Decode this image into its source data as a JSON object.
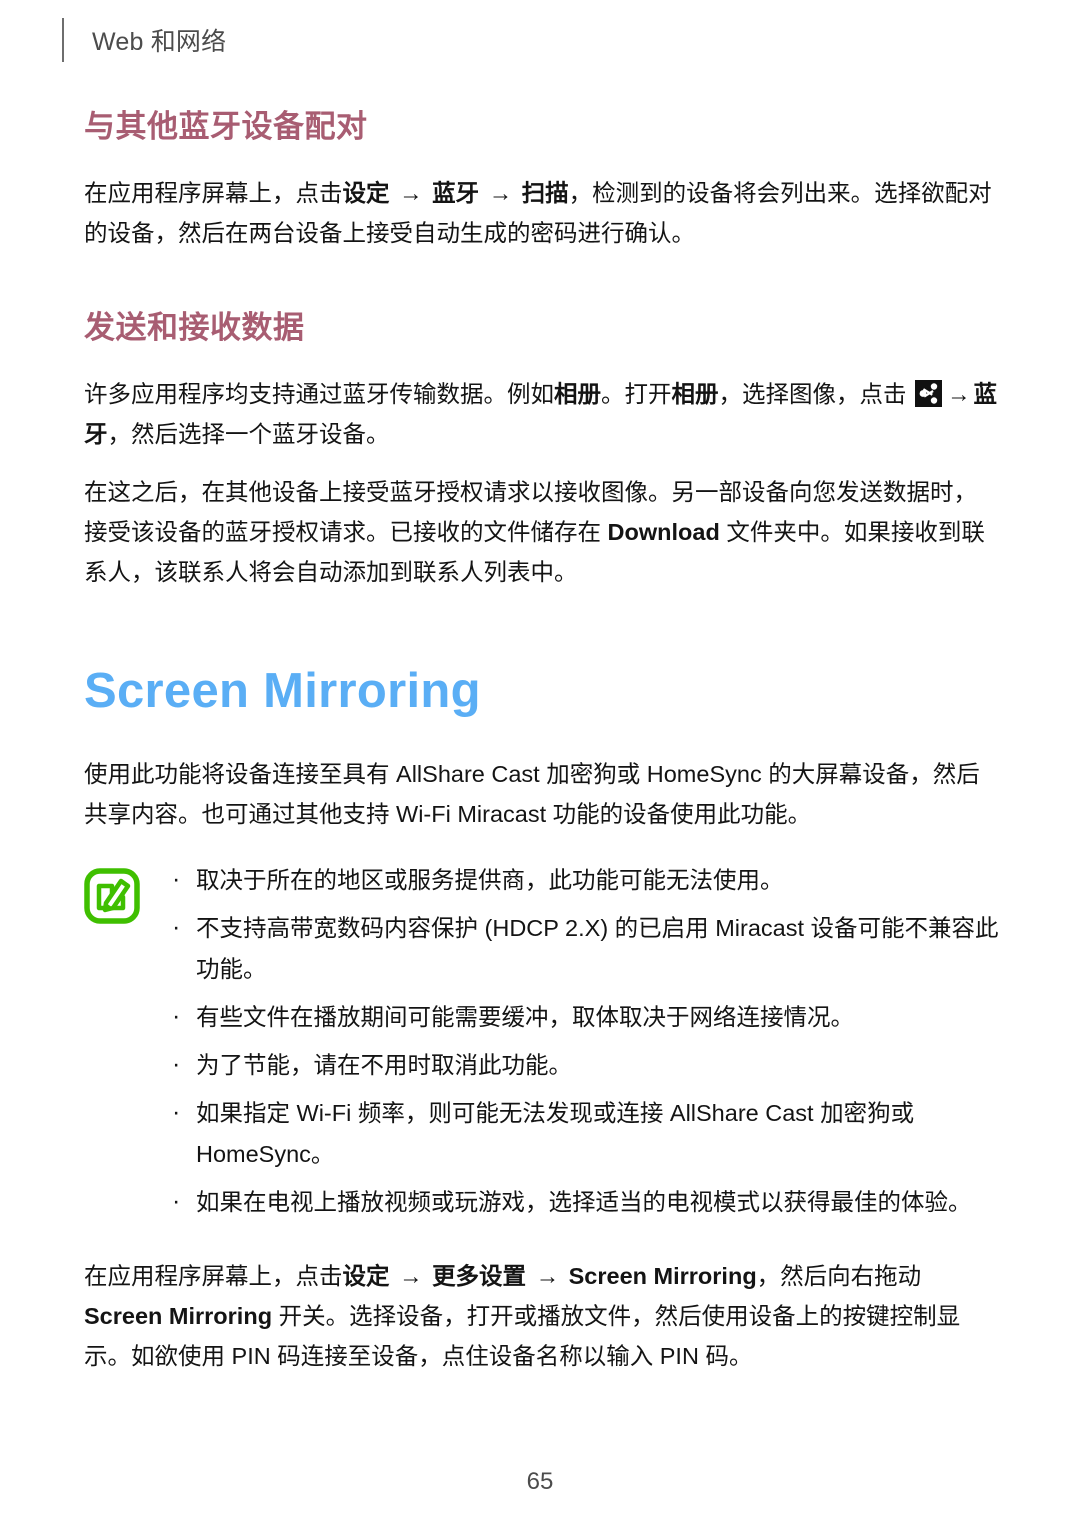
{
  "header": {
    "title": "Web 和网络",
    "rule_icon": "vertical-rule-icon"
  },
  "sections": [
    {
      "heading": "与其他蓝牙设备配对",
      "heading_color": "#a85d72",
      "paragraph_runs": [
        {
          "text": "在应用程序屏幕上，点击",
          "bold": false
        },
        {
          "text": "设定",
          "bold": true
        },
        {
          "text": " → ",
          "bold": false
        },
        {
          "text": "蓝牙",
          "bold": true
        },
        {
          "text": " → ",
          "bold": false
        },
        {
          "text": "扫描",
          "bold": true
        },
        {
          "text": "，检测到的设备将会列出来。选择欲配对的设备，然后在两台设备上接受自动生成的密码进行确认。",
          "bold": false
        }
      ],
      "paragraph_plain": "在应用程序屏幕上，点击设定 → 蓝牙 → 扫描，检测到的设备将会列出来。选择欲配对的设备，然后在两台设备上接受自动生成的密码进行确认。"
    },
    {
      "heading": "发送和接收数据",
      "heading_color": "#a85d72",
      "paragraph_plain": "许多应用程序均支持通过蓝牙传输数据。例如相册。打开相册，选择图像，点击 [share] → 蓝牙，然后选择一个蓝牙设备。",
      "paragraph2_plain": "在这之后，在其他设备上接受蓝牙授权请求以接收图像。另一部设备向您发送数据时，接受该设备的蓝牙授权请求。已接收的文件储存在 Download 文件夹中。如果接收到联系人，该联系人将会自动添加到联系人列表中。"
    }
  ],
  "send_receive": {
    "run1": "许多应用程序均支持通过蓝牙传输数据。例如",
    "bold_album_1": "相册",
    "run2": "。打开",
    "bold_album_2": "相册",
    "run3": "，选择图像，点击 ",
    "share_icon_name": "share-icon",
    "arrow": "→",
    "bold_bluetooth": "蓝牙",
    "run4": "，然后选择一个蓝牙设备。",
    "para2_run1": "在这之后，在其他设备上接受蓝牙授权请求以接收图像。另一部设备向您发送数据时，接受该设备的蓝牙授权请求。已接收的文件储存在 ",
    "para2_bold": "Download",
    "para2_run2": " 文件夹中。如果接收到联系人，该联系人将会自动添加到联系人列表中。"
  },
  "screen_mirroring": {
    "title": "Screen Mirroring",
    "title_color": "#5aaef5",
    "intro": "使用此功能将设备连接至具有 AllShare Cast 加密狗或 HomeSync 的大屏幕设备，然后共享内容。也可通过其他支持 Wi-Fi Miracast 功能的设备使用此功能。",
    "note_icon_name": "note-pencil-icon",
    "note_icon_color": "#3fbf00",
    "notes": [
      "取决于所在的地区或服务提供商，此功能可能无法使用。",
      "不支持高带宽数码内容保护 (HDCP 2.X) 的已启用 Miracast 设备可能不兼容此功能。",
      "有些文件在播放期间可能需要缓冲，取体取决于网络连接情况。",
      "为了节能，请在不用时取消此功能。",
      "如果指定 Wi-Fi 频率，则可能无法发现或连接 AllShare Cast 加密狗或 HomeSync。",
      "如果在电视上播放视频或玩游戏，选择适当的电视模式以获得最佳的体验。"
    ],
    "steps_run1": "在应用程序屏幕上，点击",
    "steps_bold1": "设定",
    "steps_arrow1": " → ",
    "steps_bold2": "更多设置",
    "steps_arrow2": " → ",
    "steps_bold3": "Screen Mirroring",
    "steps_run2": "，然后向右拖动 ",
    "steps_bold4": "Screen Mirroring",
    "steps_run3": " 开关。选择设备，打开或播放文件，然后使用设备上的按键控制显示。如欲使用 PIN 码连接至设备，点住设备名称以输入 PIN 码。"
  },
  "footer": {
    "page_number": "65"
  }
}
